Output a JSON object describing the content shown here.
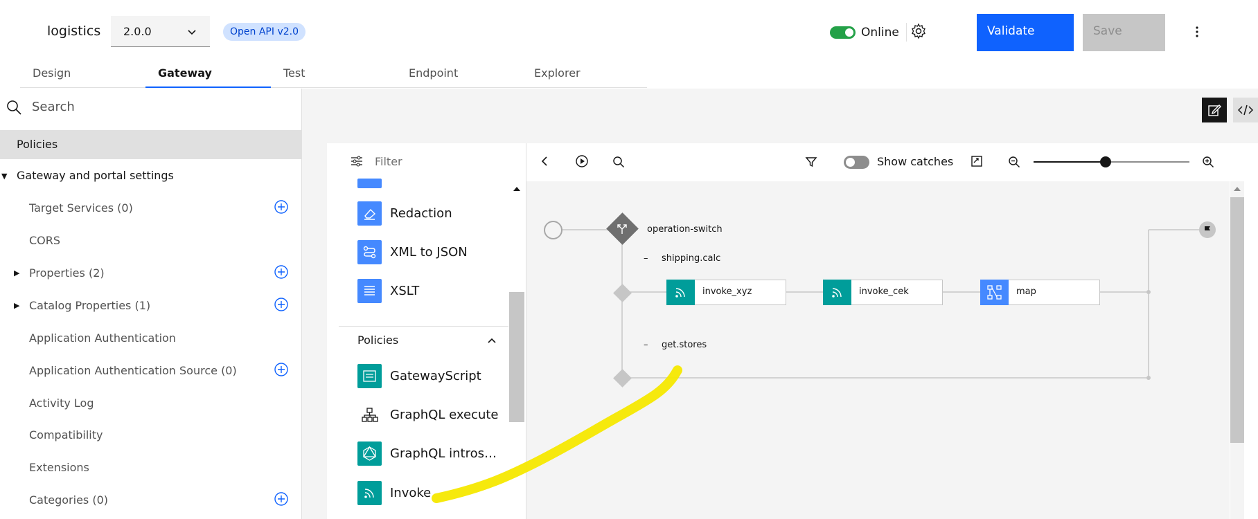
{
  "header": {
    "api_name": "logistics",
    "version": "2.0.0",
    "badge": "Open API v2.0",
    "online_label": "Online",
    "validate_label": "Validate",
    "save_label": "Save"
  },
  "tabs": [
    {
      "label": "Design"
    },
    {
      "label": "Gateway",
      "active": true
    },
    {
      "label": "Test"
    },
    {
      "label": "Endpoint"
    },
    {
      "label": "Explorer"
    }
  ],
  "sidebar": {
    "search_placeholder": "Search",
    "policies_label": "Policies",
    "section_label": "Gateway and portal settings",
    "items": [
      {
        "label": "Target Services (0)"
      },
      {
        "label": "CORS"
      },
      {
        "label": "Properties (2)"
      },
      {
        "label": "Catalog Properties (1)"
      },
      {
        "label": "Application Authentication"
      },
      {
        "label": "Application Authentication Source (0)"
      },
      {
        "label": "Activity Log"
      },
      {
        "label": "Compatibility"
      },
      {
        "label": "Extensions"
      },
      {
        "label": "Categories (0)"
      }
    ]
  },
  "palette": {
    "filter_placeholder": "Filter",
    "transforms": [
      {
        "label": "Redaction",
        "icon": "eraser-icon"
      },
      {
        "label": "XML to JSON",
        "icon": "flow-icon"
      },
      {
        "label": "XSLT",
        "icon": "list-icon"
      }
    ],
    "policies_header": "Policies",
    "policies": [
      {
        "label": "GatewayScript",
        "icon": "script-icon"
      },
      {
        "label": "GraphQL execute",
        "icon": "hierarchy-icon"
      },
      {
        "label": "GraphQL intros…",
        "icon": "graphql-icon"
      },
      {
        "label": "Invoke",
        "icon": "rss-icon"
      }
    ]
  },
  "canvas": {
    "show_catches_label": "Show catches",
    "switch_label": "operation-switch",
    "case1_label": "shipping.calc",
    "case2_label": "get.stores",
    "case_dash": "–",
    "nodes": [
      {
        "label": "invoke_xyz",
        "color": "#009d9a"
      },
      {
        "label": "invoke_cek",
        "color": "#009d9a"
      },
      {
        "label": "map",
        "color": "#4589ff"
      }
    ],
    "zoom_level": 0.46
  },
  "colors": {
    "primary": "#0f62fe",
    "teal": "#009d9a",
    "blue_icon": "#4589ff",
    "online": "#24a148",
    "annotation": "#f5e800"
  }
}
